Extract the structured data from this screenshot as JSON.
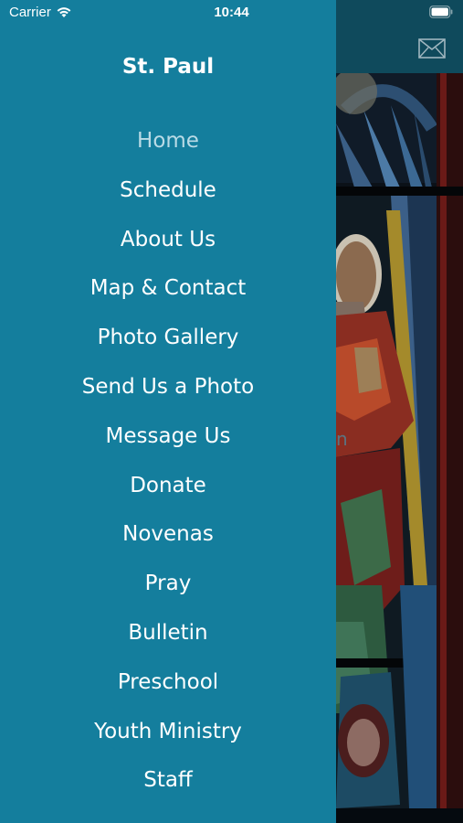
{
  "status_bar": {
    "carrier": "Carrier",
    "time": "10:44",
    "wifi_icon": "wifi-icon",
    "battery_icon": "battery-icon"
  },
  "background": {
    "mail_icon": "mail-icon",
    "text_fragment": "n"
  },
  "drawer": {
    "title": "St. Paul",
    "background_color": "#147e9d",
    "active_color": "#b9dbe6",
    "items": [
      {
        "label": "Home",
        "active": true
      },
      {
        "label": "Schedule"
      },
      {
        "label": "About Us"
      },
      {
        "label": "Map & Contact"
      },
      {
        "label": "Photo Gallery"
      },
      {
        "label": "Send Us a Photo"
      },
      {
        "label": "Message Us"
      },
      {
        "label": "Donate"
      },
      {
        "label": "Novenas"
      },
      {
        "label": "Pray"
      },
      {
        "label": "Bulletin"
      },
      {
        "label": "Preschool"
      },
      {
        "label": "Youth Ministry"
      },
      {
        "label": "Staff"
      }
    ]
  }
}
